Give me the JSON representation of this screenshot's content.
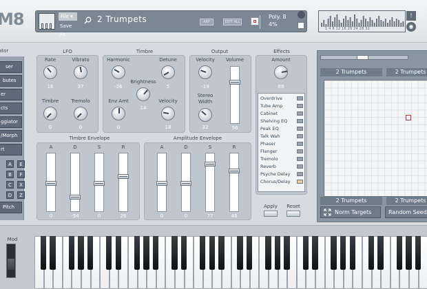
{
  "header": {
    "logo": "M8",
    "file_label": "File ▾",
    "save_label": "Save As",
    "preset_name": "2 Trumpets",
    "arp_label": "ARP",
    "edit_all_label": "EDIT ALL",
    "poly_line1": "Poly. 8",
    "poly_line2": "4%",
    "meter_labels": "1 4 8 12 16 20 24 28 32",
    "help_label": "!",
    "vmeter_levels": [
      0.3,
      0.5,
      0.2,
      0.6,
      0.8,
      0.4,
      0.7,
      0.9,
      0.5,
      0.3,
      0.6,
      0.8,
      0.5,
      0.7,
      0.4,
      0.9,
      0.6,
      0.3,
      0.5,
      0.8,
      0.6,
      0.4,
      0.7,
      0.5,
      0.3,
      0.6,
      0.8,
      0.5,
      0.4,
      0.6,
      0.3,
      0.5,
      0.7,
      0.4,
      0.6,
      0.5,
      0.3,
      0.4
    ]
  },
  "left": {
    "title": "ator",
    "buttons": [
      "ser",
      "butes",
      "er",
      "cts",
      "ggiator",
      "/Morph",
      "rt"
    ],
    "letters": [
      "A",
      "E",
      "B",
      "F",
      "C",
      "X",
      "D",
      "Z"
    ],
    "pitch": "Pitch"
  },
  "lfo": {
    "title": "LFO",
    "rate": {
      "label": "Rate",
      "value": "16"
    },
    "vibrato": {
      "label": "Vibrato",
      "value": "37"
    },
    "timbre": {
      "label": "Timbre",
      "value": "0"
    },
    "tremolo": {
      "label": "Tremolo",
      "value": "0"
    }
  },
  "timbre": {
    "title": "Timbre",
    "harmonic": {
      "label": "Harmonic",
      "value": "-26"
    },
    "detune": {
      "label": "Detune",
      "value": "5"
    },
    "brightness": {
      "label": "Brightness",
      "value": "14"
    },
    "env_amt": {
      "label": "Env Amt",
      "value": "0"
    },
    "velocity": {
      "label": "Velocity",
      "value": "18"
    }
  },
  "output": {
    "title": "Output",
    "velocity": {
      "label": "Velocity",
      "value": "-19"
    },
    "stereo": {
      "label": "Stereo Width",
      "value": "32"
    },
    "volume": {
      "label": "Volume",
      "value": "56"
    }
  },
  "timbre_env": {
    "title": "Timbre Envelope",
    "labels": [
      "A",
      "D",
      "S",
      "R"
    ],
    "values": [
      "0",
      "-54",
      "0",
      "26"
    ]
  },
  "amp_env": {
    "title": "Amplitude Envelope",
    "labels": [
      "A",
      "D",
      "S",
      "R"
    ],
    "values": [
      "0",
      "0",
      "77",
      "48"
    ]
  },
  "effects": {
    "title": "Effects",
    "amount_label": "Amount",
    "amount_value": "88",
    "items": [
      "Overdrive",
      "Tube Amp",
      "Cabinet",
      "Shelving EQ",
      "Peak EQ",
      "Talk Wah",
      "Phaser",
      "Flanger",
      "Tremolo",
      "Reverb",
      "Psyche Delay",
      "Chorus/Delay"
    ],
    "active_index": 11,
    "apply": "Apply",
    "reset": "Reset"
  },
  "xy": {
    "top_left": "2 Trumpets",
    "top_right": "2 Trumpets",
    "bottom_left": "2 Trumpets",
    "bottom_right": "2 Trumpets",
    "norm_targets": "Norm Targets",
    "random_seed": "Random Seed"
  },
  "keyboard": {
    "mod_label": "Mod"
  }
}
